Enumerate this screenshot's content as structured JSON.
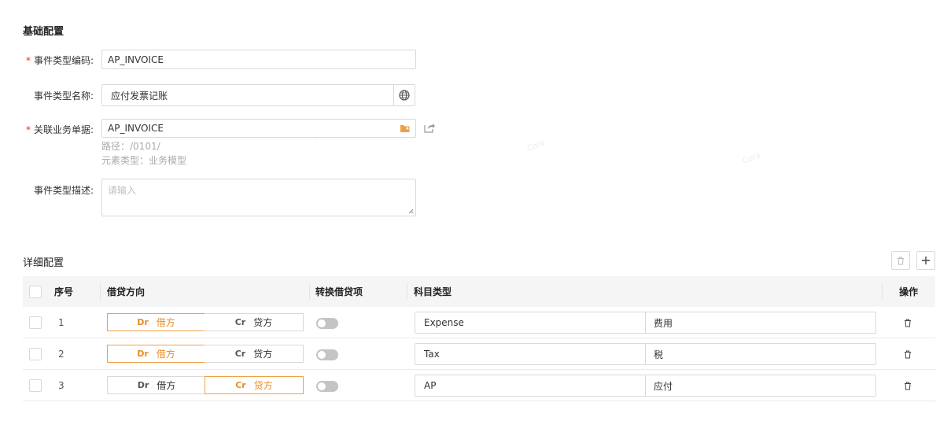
{
  "basic": {
    "title": "基础配置",
    "fields": {
      "code": {
        "label": "事件类型编码:",
        "value": "AP_INVOICE",
        "required": true
      },
      "name": {
        "label": "事件类型名称:",
        "value": "应付发票记账",
        "icon": "globe-icon"
      },
      "bizdoc": {
        "label": "关联业务单据:",
        "value": "AP_INVOICE",
        "required": true,
        "icon": "folder-icon",
        "extra_icon": "share-icon",
        "hint_path": "路径：/0101/",
        "hint_type": "元素类型：业务模型"
      },
      "desc": {
        "label": "事件类型描述:",
        "placeholder": "请输入"
      }
    }
  },
  "detail": {
    "title": "详细配置",
    "columns": {
      "seq": "序号",
      "direction": "借贷方向",
      "convert": "转换借贷项",
      "account": "科目类型",
      "action": "操作"
    },
    "dr_code": "Dr",
    "dr_label": "借方",
    "cr_code": "Cr",
    "cr_label": "贷方",
    "rows": [
      {
        "seq": "1",
        "direction": "Dr",
        "convert": false,
        "account_code": "Expense",
        "account_name": "费用"
      },
      {
        "seq": "2",
        "direction": "Dr",
        "convert": false,
        "account_code": "Tax",
        "account_name": "税"
      },
      {
        "seq": "3",
        "direction": "Cr",
        "convert": false,
        "account_code": "AP",
        "account_name": "应付"
      }
    ]
  },
  "colors": {
    "required": "#e0362c",
    "accent": "#ec8b1e",
    "folder": "#f0a044"
  }
}
